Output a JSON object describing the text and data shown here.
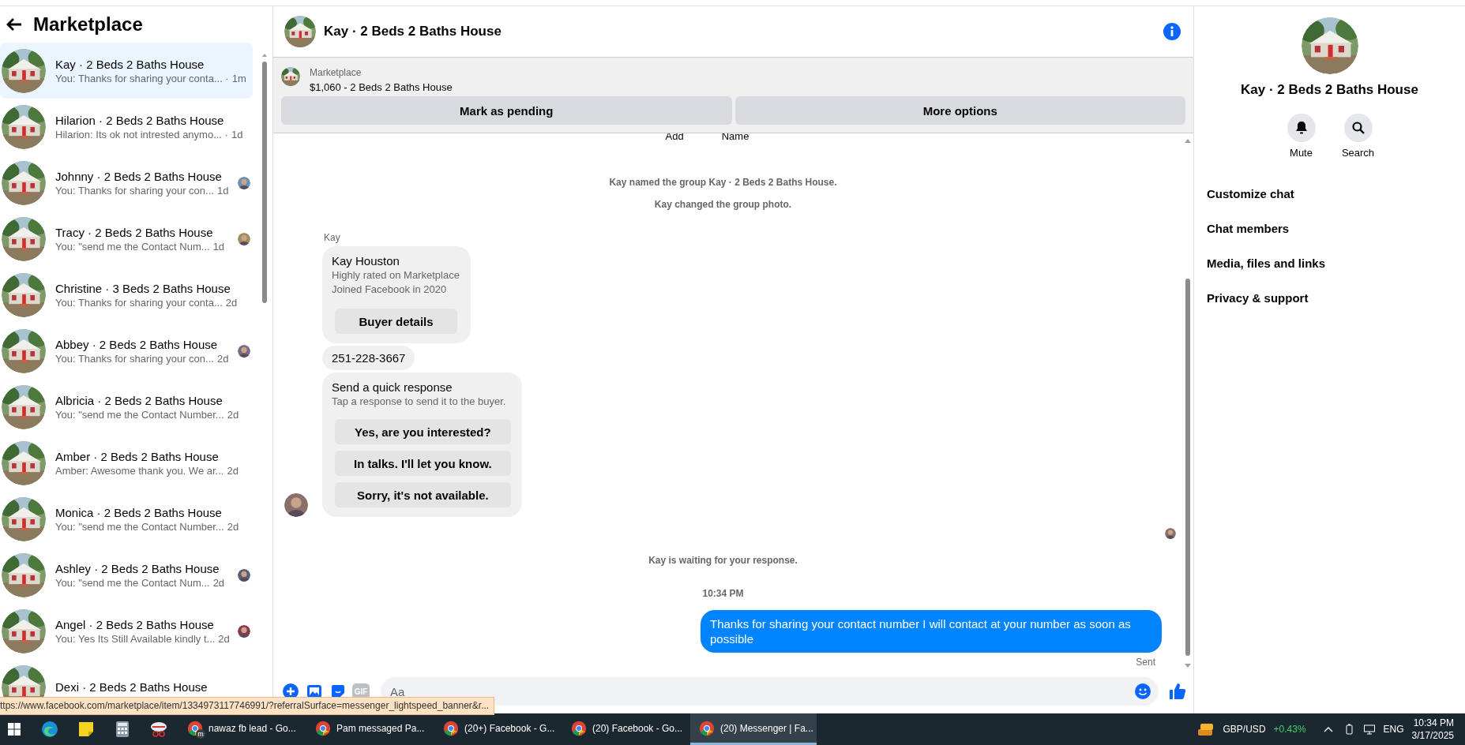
{
  "sidebar": {
    "title": "Marketplace",
    "conversations": [
      {
        "name": "Kay · 2 Beds 2 Baths House",
        "preview": "You: Thanks for sharing your conta... ·",
        "time": "1m",
        "selected": true,
        "read": false
      },
      {
        "name": "Hilarion · 2 Beds 2 Baths House",
        "preview": "Hilarion: Its ok not intrested anymo... ·",
        "time": "1d",
        "selected": false,
        "read": false
      },
      {
        "name": "Johnny · 2 Beds 2 Baths House",
        "preview": "You: Thanks for sharing your con...",
        "time": "1d",
        "selected": false,
        "read": true
      },
      {
        "name": "Tracy · 2 Beds 2 Baths House",
        "preview": "You: \"send me the Contact Num...",
        "time": "1d",
        "selected": false,
        "read": true
      },
      {
        "name": "Christine · 3 Beds 2 Baths House",
        "preview": "You: Thanks for sharing your conta...",
        "time": "2d",
        "selected": false,
        "read": false
      },
      {
        "name": "Abbey · 2 Beds 2 Baths House",
        "preview": "You: Thanks for sharing your con...",
        "time": "2d",
        "selected": false,
        "read": true
      },
      {
        "name": "Albricia · 2 Beds 2 Baths House",
        "preview": "You: \"send me the Contact Number...",
        "time": "2d",
        "selected": false,
        "read": false
      },
      {
        "name": "Amber · 2 Beds 2 Baths House",
        "preview": "Amber: Awesome thank you. We ar...",
        "time": "2d",
        "selected": false,
        "read": false
      },
      {
        "name": "Monica · 2 Beds 2 Baths House",
        "preview": "You: \"send me the Contact Number...",
        "time": "2d",
        "selected": false,
        "read": false
      },
      {
        "name": "Ashley · 2 Beds 2 Baths House",
        "preview": "You: \"send me the Contact Num...",
        "time": "2d",
        "selected": false,
        "read": true
      },
      {
        "name": "Angel · 2 Beds 2 Baths House",
        "preview": "You: Yes Its Still Available kindly t...",
        "time": "2d",
        "selected": false,
        "read": true
      },
      {
        "name": "Dexi · 2 Beds 2 Baths House",
        "selected": false,
        "read": false
      }
    ]
  },
  "chat": {
    "title": "Kay · 2 Beds 2 Baths House",
    "listing": {
      "source": "Marketplace",
      "item": "$1,060 - 2 Beds 2 Baths House",
      "buttons": [
        "Mark as pending",
        "More options"
      ]
    },
    "cut_off": [
      "Add",
      "Name"
    ],
    "timeline": [
      {
        "kind": "system",
        "text": "Kay named the group Kay · 2 Beds 2 Baths House."
      },
      {
        "kind": "system",
        "text": "Kay changed the group photo."
      },
      {
        "kind": "sender",
        "text": "Kay"
      },
      {
        "kind": "profile",
        "name": "Kay Houston",
        "lines": [
          "Highly rated on Marketplace",
          "Joined Facebook in 2020"
        ],
        "button": "Buyer details"
      },
      {
        "kind": "incoming",
        "text": "251-228-3667"
      },
      {
        "kind": "quick",
        "title": "Send a quick response",
        "hint": "Tap a response to send it to the buyer.",
        "options": [
          "Yes, are you interested?",
          "In talks. I'll let you know.",
          "Sorry, it's not available."
        ]
      },
      {
        "kind": "receipt"
      },
      {
        "kind": "system",
        "text": "Kay is waiting for your response."
      },
      {
        "kind": "time",
        "text": "10:34 PM"
      },
      {
        "kind": "outgoing",
        "text": "Thanks for sharing your contact number I will contact at your number as soon as possible"
      },
      {
        "kind": "status",
        "text": "Sent"
      }
    ],
    "composer": {
      "gif": "GIF",
      "placeholder": "Aa"
    }
  },
  "details": {
    "title": "Kay · 2 Beds 2 Baths House",
    "actions": [
      {
        "kind": "bell",
        "label": "Mute"
      },
      {
        "kind": "search",
        "label": "Search"
      }
    ],
    "menu": [
      "Customize chat",
      "Chat members",
      "Media, files and links",
      "Privacy & support"
    ]
  },
  "status_url": "ttps://www.facebook.com/marketplace/item/1334973117746991/?referralSurface=messenger_lightspeed_banner&r...",
  "taskbar": {
    "windows": [
      {
        "label": "nawaz fb lead - Go...",
        "selected": false,
        "badge": "m"
      },
      {
        "label": "Pam messaged Pa...",
        "selected": false
      },
      {
        "label": "(20+) Facebook - G...",
        "selected": false
      },
      {
        "label": "(20) Facebook - Go...",
        "selected": false
      },
      {
        "label": "(20) Messenger | Fa...",
        "selected": true
      }
    ],
    "ticker": "GBP/USD",
    "change": "+0.43%",
    "language": "ENG",
    "time": "10:34 PM",
    "date": "3/17/2025"
  }
}
